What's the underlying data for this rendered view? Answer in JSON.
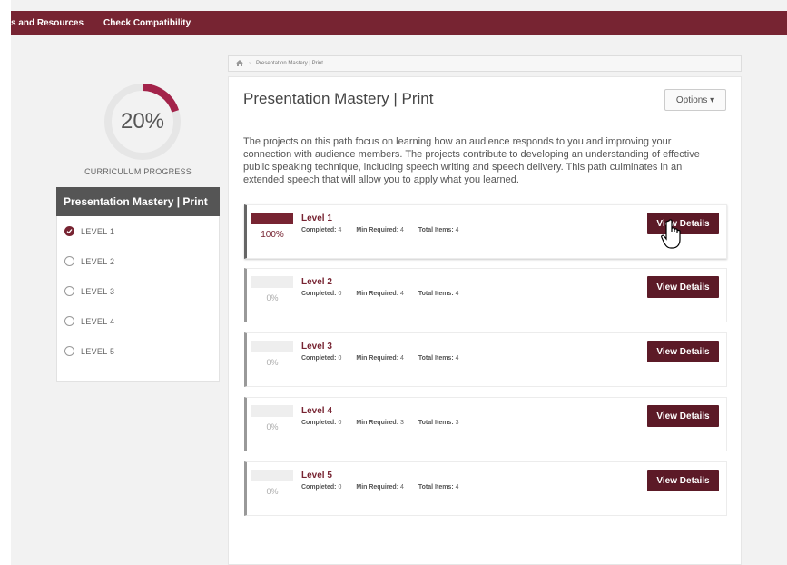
{
  "topnav": {
    "items": [
      "s and Resources",
      "Check Compatibility"
    ]
  },
  "progress": {
    "percent_text": "20%",
    "percent": 0.2,
    "label": "CURRICULUM PROGRESS"
  },
  "leftnav": {
    "title": "Presentation Mastery | Print",
    "items": [
      {
        "label": "LEVEL 1",
        "checked": true
      },
      {
        "label": "LEVEL 2",
        "checked": false
      },
      {
        "label": "LEVEL 3",
        "checked": false
      },
      {
        "label": "LEVEL 4",
        "checked": false
      },
      {
        "label": "LEVEL 5",
        "checked": false
      }
    ]
  },
  "breadcrumb": {
    "home_icon": "home-icon",
    "current": "Presentation Mastery | Print"
  },
  "main": {
    "title": "Presentation Mastery | Print",
    "options_label": "Options ▾",
    "description": "The projects on this path focus on learning how an audience responds to you and improving your connection with audience members. The projects contribute to developing an understanding of effective public speaking technique, including speech writing and speech delivery. This path culminates in an extended speech that will allow you to apply what you learned."
  },
  "levels": [
    {
      "name": "Level 1",
      "pct": "100%",
      "fill": 1.0,
      "completed_label": "Completed:",
      "completed": "4",
      "min_label": "Min Required:",
      "min": "4",
      "total_label": "Total Items:",
      "total": "4",
      "button": "View Details"
    },
    {
      "name": "Level 2",
      "pct": "0%",
      "fill": 0,
      "completed_label": "Completed:",
      "completed": "0",
      "min_label": "Min Required:",
      "min": "4",
      "total_label": "Total Items:",
      "total": "4",
      "button": "View Details"
    },
    {
      "name": "Level 3",
      "pct": "0%",
      "fill": 0,
      "completed_label": "Completed:",
      "completed": "0",
      "min_label": "Min Required:",
      "min": "4",
      "total_label": "Total Items:",
      "total": "4",
      "button": "View Details"
    },
    {
      "name": "Level 4",
      "pct": "0%",
      "fill": 0,
      "completed_label": "Completed:",
      "completed": "0",
      "min_label": "Min Required:",
      "min": "3",
      "total_label": "Total Items:",
      "total": "3",
      "button": "View Details"
    },
    {
      "name": "Level 5",
      "pct": "0%",
      "fill": 0,
      "completed_label": "Completed:",
      "completed": "0",
      "min_label": "Min Required:",
      "min": "4",
      "total_label": "Total Items:",
      "total": "4",
      "button": "View Details"
    }
  ],
  "colors": {
    "brand": "#772432",
    "button": "#5c1a27"
  }
}
